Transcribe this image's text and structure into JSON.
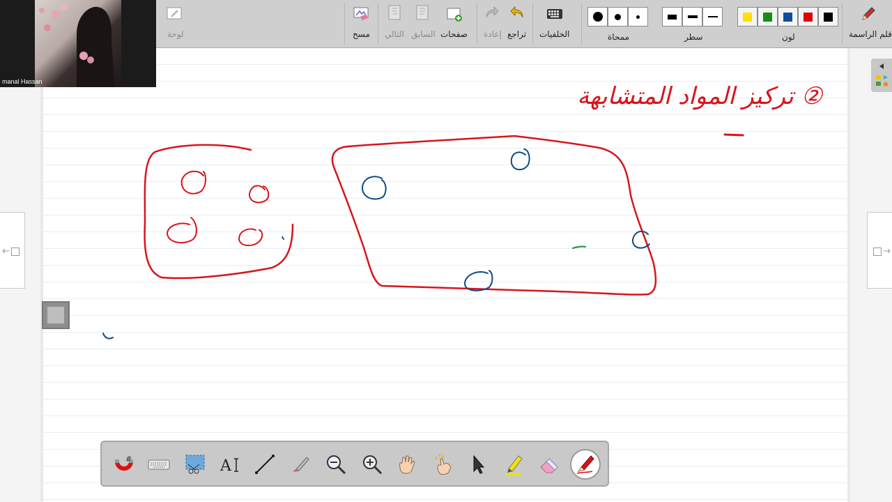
{
  "toolbar": {
    "pen_label": "قلم الراسمة",
    "color_label": "لون",
    "line_label": "سطر",
    "eraser_label": "ممحاة",
    "backgrounds_label": "الخلفيات",
    "undo_label": "تراجع",
    "redo_label": "إعادة",
    "pages_label": "صفحات",
    "prev_label": "السابق",
    "next_label": "التالي",
    "clear_label": "مسح",
    "board_label": "لوحة",
    "colors": [
      "#000000",
      "#e00000",
      "#0b4f9c",
      "#119011",
      "#ffe000"
    ]
  },
  "webcam": {
    "participant_name": "manal Hassan"
  },
  "canvas": {
    "heading_text": "② تركيز المواد المتشابهة",
    "ink_red": "#d8141b",
    "ink_blue": "#0b4a86",
    "ink_green": "#1d8a33"
  },
  "floating_toolbar": {
    "tools": [
      "magic-snap",
      "keyboard",
      "screen-capture",
      "text",
      "line",
      "pen",
      "zoom-out",
      "zoom-in",
      "pan",
      "touch-select",
      "select",
      "highlighter",
      "eraser",
      "pen-active"
    ]
  }
}
